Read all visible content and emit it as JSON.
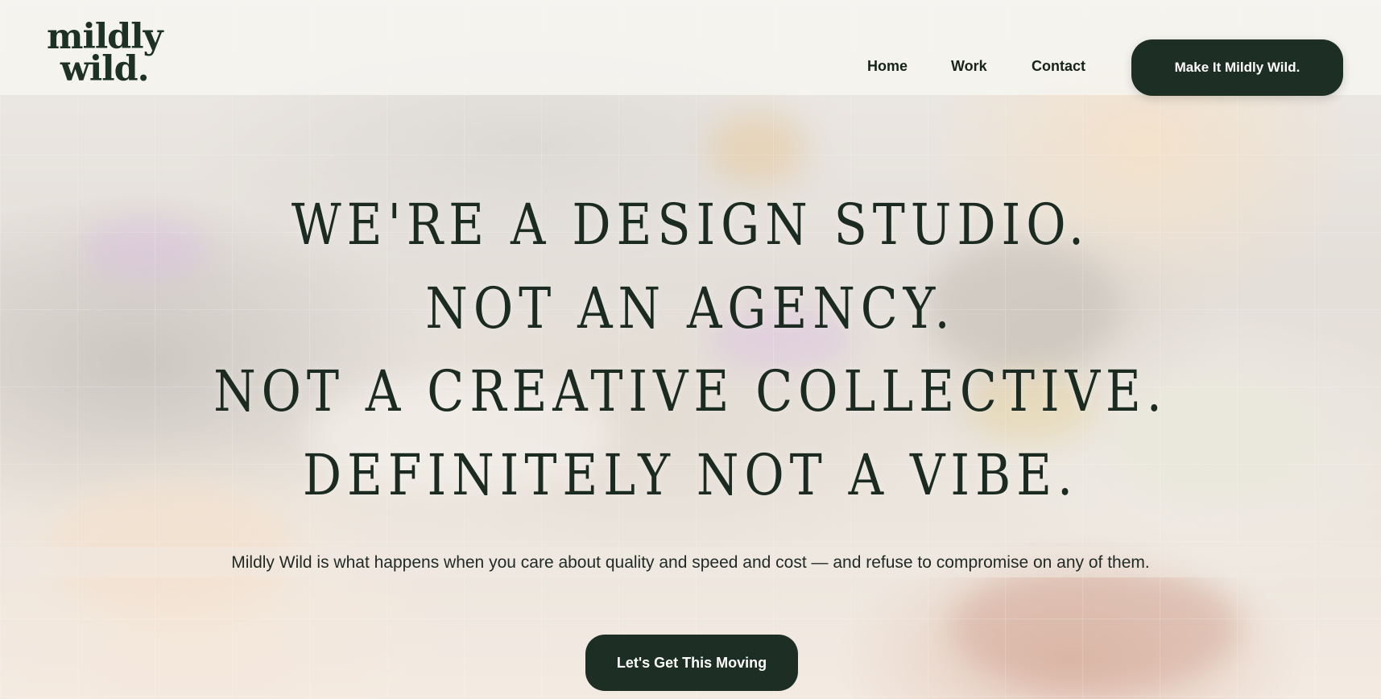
{
  "header": {
    "logo_line1": "mildly",
    "logo_line2": "wild.",
    "nav": [
      {
        "label": "Home"
      },
      {
        "label": "Work"
      },
      {
        "label": "Contact"
      }
    ],
    "cta_label": "Make It Mildly Wild."
  },
  "hero": {
    "headline_lines": [
      "We're a design studio.",
      "Not an agency.",
      "Not a creative collective.",
      "Definitely not a vibe."
    ],
    "subline": "Mildly Wild is what happens when you care about quality and speed and cost — and refuse to compromise on any of them.",
    "cta_label": "Let's Get This Moving"
  },
  "colors": {
    "brand_dark": "#1d2e24",
    "text": "#1c2b22",
    "header_bg": "#f6f4f0"
  }
}
